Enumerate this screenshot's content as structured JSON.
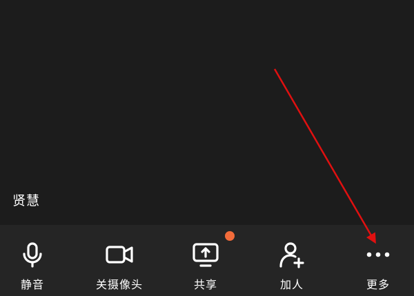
{
  "participant": {
    "name": "贤慧"
  },
  "toolbar": {
    "items": [
      {
        "id": "mute",
        "label": "静音",
        "icon": "microphone-icon"
      },
      {
        "id": "camera",
        "label": "关摄像头",
        "icon": "video-camera-icon"
      },
      {
        "id": "share",
        "label": "共享",
        "icon": "screen-share-icon",
        "badge": true
      },
      {
        "id": "invite",
        "label": "加人",
        "icon": "add-person-icon"
      },
      {
        "id": "more",
        "label": "更多",
        "icon": "more-dots-icon"
      }
    ]
  },
  "colors": {
    "background": "#1c1c1c",
    "toolbar": "#252525",
    "badge": "#f26b3a",
    "annotation_arrow": "#e01010"
  }
}
